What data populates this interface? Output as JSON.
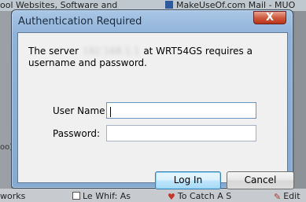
{
  "background": {
    "top_left_text": "ool Websites, Software and",
    "top_right_text": "MakeUseOf.com Mail - MUO",
    "side_text": "oo)",
    "taskbar_tabs": [
      {
        "label": "works",
        "icon": "page-icon"
      },
      {
        "label": "Le Whif: As",
        "icon": "page-icon"
      },
      {
        "label": "To Catch A S",
        "icon": "heart-icon"
      },
      {
        "label": "Edit",
        "icon": "pencil-icon"
      }
    ]
  },
  "dialog": {
    "title": "Authentication Required",
    "close_label": "X",
    "message_prefix": "The server",
    "hidden_host": "192.168.1.1",
    "message_suffix": "at WRT54GS requires a username and password.",
    "username": {
      "label": "User Name:",
      "value": ""
    },
    "password": {
      "label": "Password:",
      "value": ""
    },
    "login_label": "Log In",
    "cancel_label": "Cancel"
  },
  "colors": {
    "titlebar": "#8fb2d8",
    "close_button": "#c8452a",
    "default_button": "#bee6fd"
  }
}
